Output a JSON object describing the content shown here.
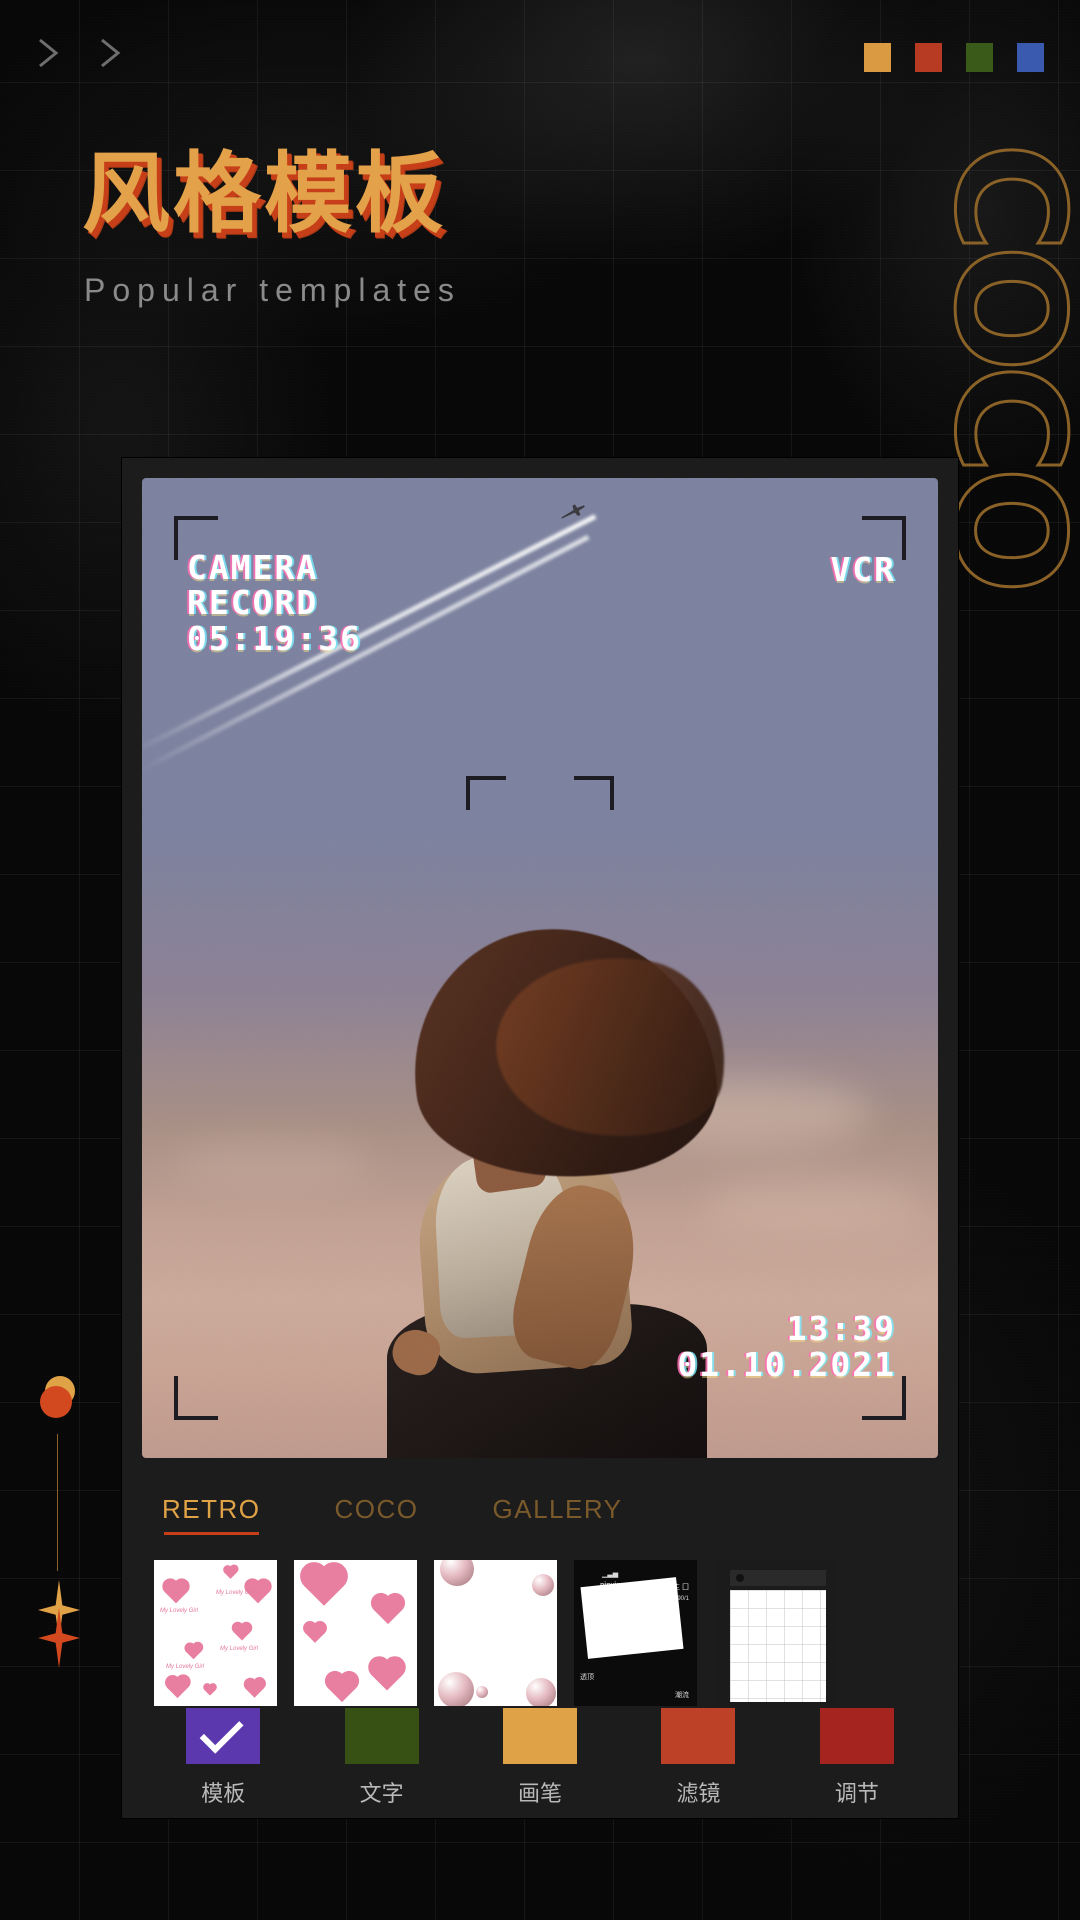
{
  "header": {
    "chevrons": [
      "chevron-right-icon",
      "chevron-right-icon"
    ],
    "swatches": [
      {
        "name": "swatch-amber",
        "color": "#D99A42"
      },
      {
        "name": "swatch-red",
        "color": "#B73A22"
      },
      {
        "name": "swatch-green",
        "color": "#3A5A1A"
      },
      {
        "name": "swatch-blue",
        "color": "#3A5AAF"
      }
    ]
  },
  "hero": {
    "title_cn": "风格模板",
    "title_en": "Popular templates",
    "title_color": "#E3A14A",
    "title_shadow_color": "#C63F18",
    "subtitle_color": "#8A8A8A"
  },
  "side_word": {
    "letters": [
      "C",
      "O",
      "C",
      "O"
    ],
    "stroke_color": "#8A6227"
  },
  "decorations": {
    "circle_top_color": "#E0A246",
    "circle_bottom_color": "#D2481F",
    "line_color": "#8A6227",
    "sparkle_top_color": "#E0A246",
    "sparkle_bottom_color": "#D2481F"
  },
  "preview": {
    "overlay": {
      "camera_label": "CAMERA",
      "record_label": "RECORD",
      "rec_timecode": "05:19:36",
      "mode_label": "VCR",
      "clock": "13:39",
      "date": "01.10.2021"
    }
  },
  "tabs": [
    {
      "label": "RETRO",
      "active": true
    },
    {
      "label": "COCO",
      "active": false
    },
    {
      "label": "GALLERY",
      "active": false
    }
  ],
  "thumbnails": [
    {
      "name": "thumb-hearts-text",
      "caption": "My Lovely Girl"
    },
    {
      "name": "thumb-hearts-big",
      "caption": ""
    },
    {
      "name": "thumb-pearl-hearts",
      "caption": ""
    },
    {
      "name": "thumb-dark-card",
      "caption": "pinyin"
    },
    {
      "name": "thumb-phone-grid",
      "caption": ""
    }
  ],
  "thumb_dark_texts": {
    "brand": "pinyin",
    "right_top": "主 囗",
    "right_sub": "890/1",
    "left_bottom": "透顶",
    "right_bottom": "潮流"
  },
  "toolbar": [
    {
      "label": "模板",
      "color": "#5B38AD",
      "selected": true
    },
    {
      "label": "文字",
      "color": "#375014",
      "selected": false
    },
    {
      "label": "画笔",
      "color": "#E0A246",
      "selected": false
    },
    {
      "label": "滤镜",
      "color": "#BC4126",
      "selected": false
    },
    {
      "label": "调节",
      "color": "#A62420",
      "selected": false
    }
  ]
}
